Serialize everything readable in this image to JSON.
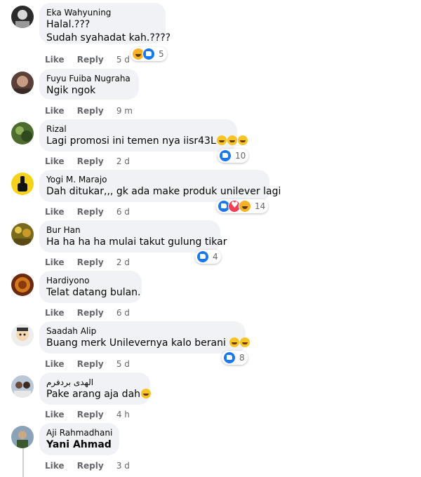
{
  "comments": [
    {
      "author": "Eka Wahyuning",
      "lines": [
        "Halal.???",
        "Sudah syahadat kah.????"
      ],
      "reaction_count": "5",
      "like": "Like",
      "reply": "Reply",
      "time": "5 d"
    },
    {
      "author": "Fuyu Fuiba Nugraha",
      "lines": [
        "Ngik ngok"
      ],
      "reaction_count": "",
      "like": "Like",
      "reply": "Reply",
      "time": "9 m"
    },
    {
      "author": "Rizal",
      "lines": [
        "Lagi promosi ini temen nya iisr43L"
      ],
      "reaction_count": "10",
      "like": "Like",
      "reply": "Reply",
      "time": "2 d"
    },
    {
      "author": "Yogi M. Marajo",
      "lines": [
        "Dah ditukar,,, gk ada make produk unilever lagi"
      ],
      "reaction_count": "14",
      "like": "Like",
      "reply": "Reply",
      "time": "6 d"
    },
    {
      "author": "Bur Han",
      "lines": [
        "Ha ha ha ha mulai takut gulung tikar"
      ],
      "reaction_count": "4",
      "like": "Like",
      "reply": "Reply",
      "time": "2 d"
    },
    {
      "author": "Hardiyono",
      "lines": [
        "Telat datang bulan."
      ],
      "reaction_count": "",
      "like": "Like",
      "reply": "Reply",
      "time": "6 d"
    },
    {
      "author": "Saadah Alip",
      "lines": [
        "Buang merk Unilevernya kalo berani"
      ],
      "reaction_count": "8",
      "like": "Like",
      "reply": "Reply",
      "time": "5 d"
    },
    {
      "author": "الهدى بردفرم",
      "lines": [
        "Pake arang aja dah"
      ],
      "reaction_count": "",
      "like": "Like",
      "reply": "Reply",
      "time": "4 h"
    },
    {
      "author": "Aji Rahmadhani",
      "lines": [
        "Yani Ahmad"
      ],
      "reaction_count": "",
      "like": "Like",
      "reply": "Reply",
      "time": "3 d"
    }
  ],
  "icons": {
    "like": "like-reaction-icon",
    "love": "love-reaction-icon",
    "haha": "haha-reaction-icon",
    "emoji": "laughing-emoji-icon"
  },
  "colors": {
    "bubble": "#f0f2f5",
    "like_blue": "#1877f2",
    "meta_gray": "#65676b"
  }
}
